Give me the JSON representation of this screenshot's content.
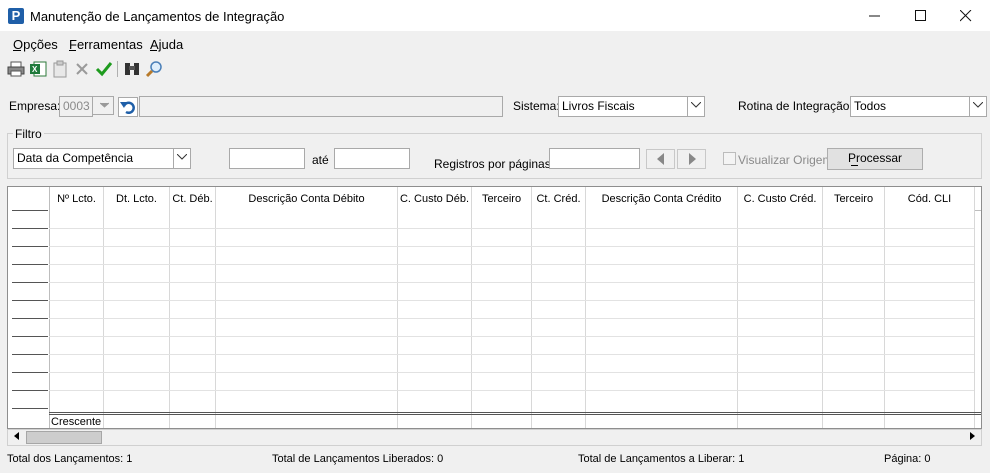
{
  "window": {
    "title": "Manutenção de Lançamentos de Integração",
    "app_icon": "P",
    "minimize": "—",
    "maximize": "☐",
    "close": "✕"
  },
  "menu": {
    "items": [
      {
        "label": "Opções"
      },
      {
        "label": "Ferramentas"
      },
      {
        "label": "Ajuda"
      }
    ]
  },
  "toolbar": {
    "icons": [
      "printer-icon",
      "excel-export-icon",
      "clipboard-icon",
      "delete-icon",
      "confirm-icon",
      "binoculars-icon",
      "zoom-icon"
    ]
  },
  "form": {
    "empresa_label": "Empresa:",
    "empresa_value": "0003",
    "empresa_name": "",
    "sistema_label": "Sistema:",
    "sistema_value": "Livros Fiscais",
    "rotina_label": "Rotina de Integração:",
    "rotina_value": "Todos"
  },
  "filter": {
    "group_label": "Filtro",
    "date_type": "Data da Competência",
    "date_from": "",
    "ate_label": "até",
    "date_to": "",
    "registros_label": "Registros por páginas:",
    "registros_value": "",
    "visualizar_label": "Visualizar Origem",
    "processar_label": "Processar"
  },
  "grid": {
    "columns": [
      "Nº Lcto.",
      "Dt. Lcto.",
      "Ct. Déb.",
      "Descrição Conta Débito",
      "C. Custo Déb.",
      "Terceiro",
      "Ct. Créd.",
      "Descrição Conta Crédito",
      "C. Custo Créd.",
      "Terceiro",
      "Cód. CLI"
    ],
    "footer_label": "Crescente"
  },
  "status": {
    "total_lancamentos": "Total dos Lançamentos: 1",
    "total_liberados": "Total de Lançamentos Liberados: 0",
    "total_a_liberar": "Total de Lançamentos a Liberar: 1",
    "pagina": "Página: 0"
  },
  "colors": {
    "accent": "#1f5fa8",
    "check": "#1e9b1e",
    "delete": "#9a9a9a"
  }
}
